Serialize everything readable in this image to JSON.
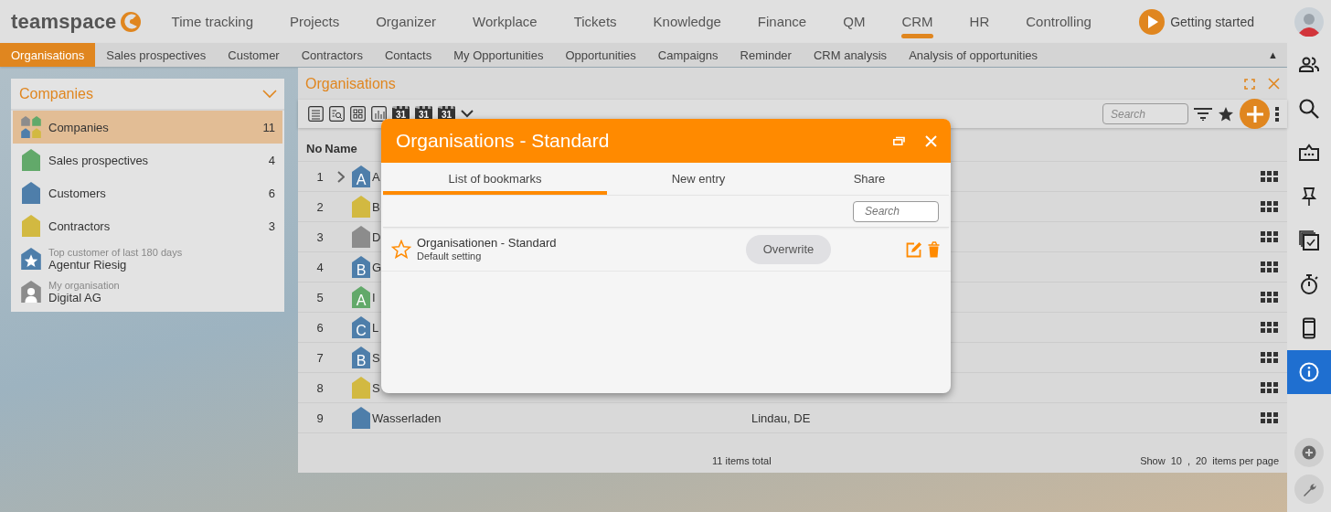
{
  "app": {
    "logo": "teamspace",
    "nav": [
      {
        "label": "Time tracking",
        "selected": false
      },
      {
        "label": "Projects",
        "selected": false
      },
      {
        "label": "Organizer",
        "selected": false
      },
      {
        "label": "Workplace",
        "selected": false
      },
      {
        "label": "Tickets",
        "selected": false
      },
      {
        "label": "Knowledge",
        "selected": false
      },
      {
        "label": "Finance",
        "selected": false
      },
      {
        "label": "QM",
        "selected": false
      },
      {
        "label": "CRM",
        "selected": true
      },
      {
        "label": "HR",
        "selected": false
      },
      {
        "label": "Controlling",
        "selected": false
      }
    ],
    "getting_started": "Getting started"
  },
  "subnav": {
    "tabs": [
      {
        "label": "Organisations",
        "selected": true
      },
      {
        "label": "Sales prospectives",
        "selected": false
      },
      {
        "label": "Customer",
        "selected": false
      },
      {
        "label": "Contractors",
        "selected": false
      },
      {
        "label": "Contacts",
        "selected": false
      },
      {
        "label": "My Opportunities",
        "selected": false
      },
      {
        "label": "Opportunities",
        "selected": false
      },
      {
        "label": "Campaigns",
        "selected": false
      },
      {
        "label": "Reminder",
        "selected": false
      },
      {
        "label": "CRM analysis",
        "selected": false
      },
      {
        "label": "Analysis of opportunities",
        "selected": false
      }
    ],
    "collapse": "▲"
  },
  "sidebar": {
    "title": "Companies",
    "items": [
      {
        "kind": "all",
        "label": "Companies",
        "count": "11",
        "selected": true
      },
      {
        "kind": "category",
        "label": "Sales prospectives",
        "count": "4",
        "color": "#62a96a",
        "selected": false
      },
      {
        "kind": "category",
        "label": "Customers",
        "count": "6",
        "color": "#4e7eaa",
        "selected": false
      },
      {
        "kind": "category",
        "label": "Contractors",
        "count": "3",
        "color": "#d2b941",
        "selected": false
      },
      {
        "kind": "top-customer",
        "caption": "Top customer of last 180 days",
        "label": "Agentur Riesig",
        "color": "#4e7eaa",
        "selected": false
      },
      {
        "kind": "own",
        "caption": "My organisation",
        "label": "Digital AG",
        "color": "#8c8c8c",
        "selected": false
      }
    ]
  },
  "panel": {
    "title": "Organisations",
    "toolbar": {
      "calendar_labels": [
        "31",
        "31",
        "31"
      ],
      "search_placeholder": "Search"
    },
    "table": {
      "columns": [
        "No",
        "Name"
      ],
      "rows": [
        {
          "no": "1",
          "badge": "A",
          "name": "A",
          "color": "#4e7eaa",
          "expandable": true
        },
        {
          "no": "2",
          "name": "B",
          "color": "#d2b941",
          "expandable": false
        },
        {
          "no": "3",
          "name": "D",
          "color": "#8c8c8c",
          "expandable": false
        },
        {
          "no": "4",
          "badge": "B",
          "name": "G",
          "color": "#4e7eaa",
          "expandable": false
        },
        {
          "no": "5",
          "badge": "A",
          "name": "I",
          "color": "#62a96a",
          "expandable": false
        },
        {
          "no": "6",
          "badge": "C",
          "name": "L",
          "color": "#4e7eaa",
          "expandable": false
        },
        {
          "no": "7",
          "badge": "B",
          "name": "S",
          "color": "#4e7eaa",
          "expandable": false
        },
        {
          "no": "8",
          "name": "S",
          "color": "#d2b941",
          "expandable": false
        },
        {
          "no": "9",
          "name": "Wasserladen",
          "city": "Lindau, DE",
          "color": "#4e7eaa",
          "expandable": false
        }
      ]
    },
    "footer": {
      "total": "11 items total",
      "show": "Show",
      "page_sizes": [
        "10",
        "20"
      ],
      "separator": ",",
      "per_page": "items per page"
    }
  },
  "dialog": {
    "title": "Organisations - Standard",
    "tabs": [
      {
        "label": "List of bookmarks",
        "selected": true
      },
      {
        "label": "New entry",
        "selected": false
      },
      {
        "label": "Share",
        "selected": false
      }
    ],
    "search_placeholder": "Search",
    "bookmarks": [
      {
        "name": "Organisationen - Standard",
        "note": "Default setting",
        "starred": false,
        "action": "Overwrite"
      }
    ]
  },
  "right_toolbar": {
    "items": [
      {
        "kind": "people",
        "selected": false
      },
      {
        "kind": "search",
        "selected": false
      },
      {
        "kind": "card",
        "selected": false
      },
      {
        "kind": "pin",
        "selected": false
      },
      {
        "kind": "checklist",
        "selected": false
      },
      {
        "kind": "stopwatch",
        "selected": false
      },
      {
        "kind": "phone",
        "selected": false
      },
      {
        "kind": "info",
        "selected": true
      }
    ],
    "bottom": [
      {
        "kind": "add"
      },
      {
        "kind": "wrench"
      }
    ]
  }
}
